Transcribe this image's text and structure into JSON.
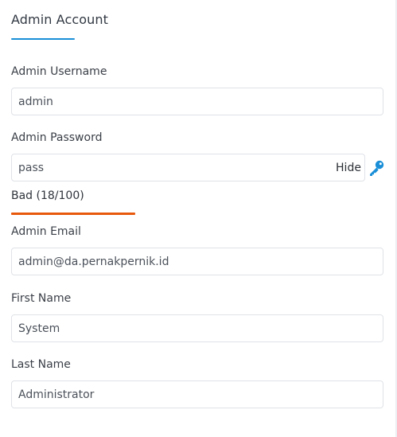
{
  "section": {
    "title": "Admin Account"
  },
  "fields": {
    "username": {
      "label": "Admin Username",
      "value": "admin"
    },
    "password": {
      "label": "Admin Password",
      "value": "pass",
      "toggle_label": "Hide"
    },
    "email": {
      "label": "Admin Email",
      "value": "admin@da.pernakpernik.id"
    },
    "first_name": {
      "label": "First Name",
      "value": "System"
    },
    "last_name": {
      "label": "Last Name",
      "value": "Administrator"
    }
  },
  "password_strength": {
    "text": "Bad (18/100)",
    "score": 18,
    "max": 100,
    "color": "#e8590c"
  },
  "icons": {
    "generate": "key-icon"
  },
  "colors": {
    "accent": "#1a8fd8",
    "strength_bad": "#e8590c"
  }
}
